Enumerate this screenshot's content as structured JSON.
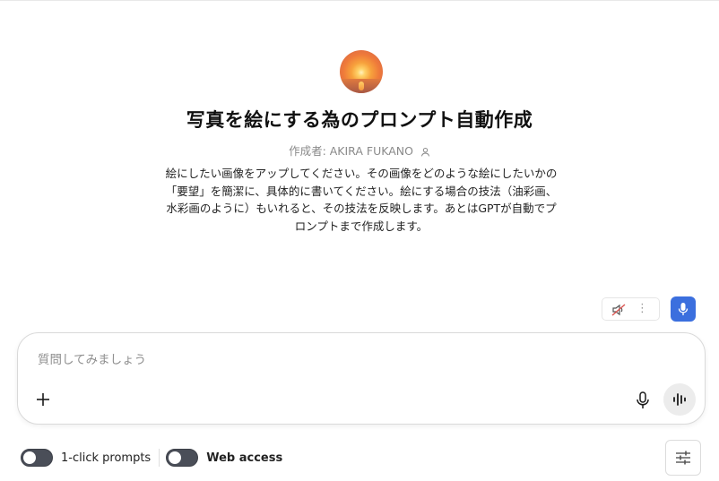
{
  "gpt": {
    "title": "写真を絵にする為のプロンプト自動作成",
    "author": "作成者: AKIRA FUKANO",
    "description": "絵にしたい画像をアップしてください。その画像をどのような絵にしたいかの「要望」を簡潔に、具体的に書いてください。絵にする場合の技法（油彩画、水彩画のように）もいれると、その技法を反映します。あとはGPTが自動でプロンプトまで作成します。"
  },
  "voice_controls": {
    "muted_icon": "speaker-muted-icon",
    "more_icon": "more-vertical-icon",
    "more_glyph": "⋮",
    "mic_icon": "microphone-icon"
  },
  "composer": {
    "placeholder": "質問してみましょう",
    "value": "",
    "add_icon": "plus-icon",
    "mic_icon": "microphone-icon",
    "voice_mode_icon": "waveform-icon"
  },
  "toggles": [
    {
      "label": "1-click prompts",
      "on": false
    },
    {
      "label": "Web access",
      "on": false
    }
  ],
  "settings_icon": "sliders-icon",
  "colors": {
    "accent": "#3b6fde",
    "toggle_off": "#4a4e58",
    "muted_icon": "#d9534f"
  }
}
